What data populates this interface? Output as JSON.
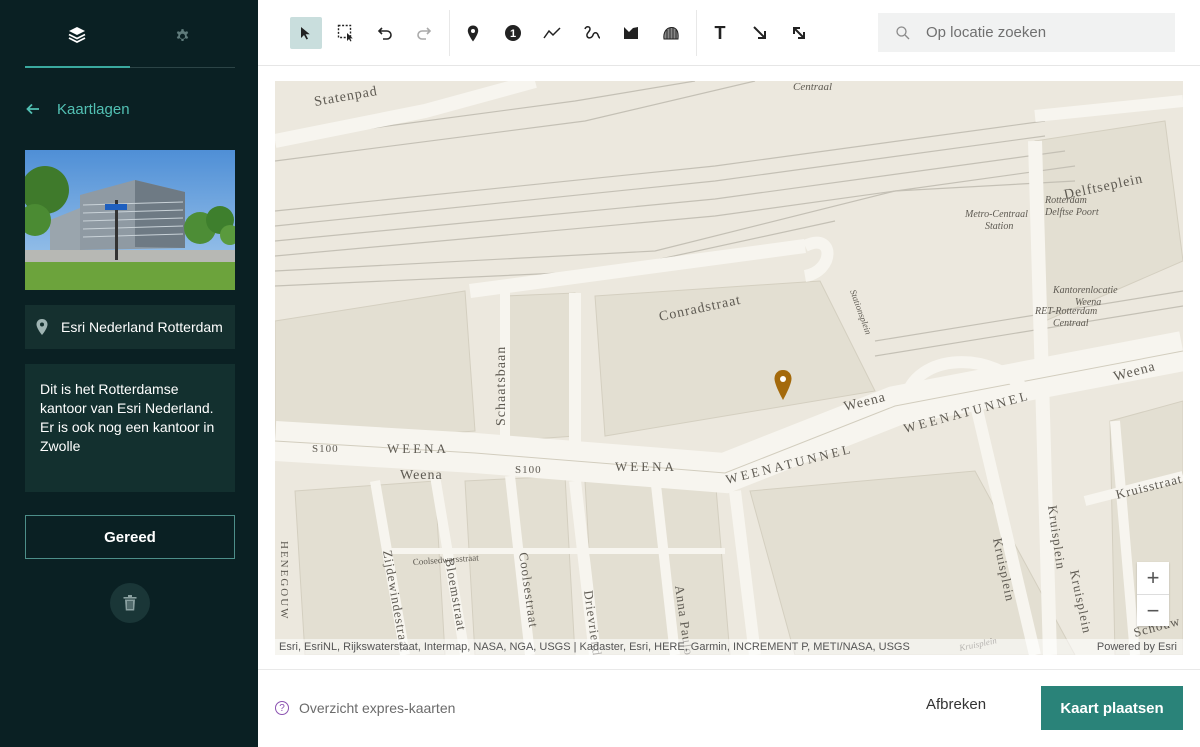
{
  "sidebar": {
    "tabs": [
      {
        "name": "layers-icon"
      },
      {
        "name": "gear-icon"
      }
    ],
    "back_label": "Kaartlagen",
    "location_text": "Esri Nederland  Rotterdam",
    "description": "Dit is het Rotterdamse kantoor van Esri Nederland. Er is ook nog een kantoor in Zwolle",
    "done_label": "Gereed"
  },
  "toolbar": {
    "tools": [
      "select-icon",
      "box-select-icon",
      "undo-icon",
      "redo-icon",
      "pin-icon",
      "numbered-marker-icon",
      "line-icon",
      "freehand-icon",
      "polygon-icon",
      "freehand-area-icon",
      "text-icon",
      "arrow-icon",
      "double-arrow-icon"
    ],
    "marker_number": "1",
    "text_tool_glyph": "T",
    "search_placeholder": "Op locatie zoeken"
  },
  "map": {
    "labels": {
      "statenpad": "Statenpad",
      "centraal_top": "Centraal",
      "delftseplein": "Delftseplein",
      "rotterdam_delftse_poort": "Rotterdam Delftse Poort",
      "metro_centraal_station": "Metro-Centraal Station",
      "conradstraat": "Conradstraat",
      "stationsplein": "Stationsplein",
      "kantorenlocatie_weena": "Kantorenlocatie Weena",
      "ret_rotterdam_centraal": "RET-Rotterdam Centraal",
      "schaatsbaan": "Schaatsbaan",
      "weena_1": "Weena",
      "weena_2": "WEENA",
      "weena_3": "Weena",
      "weena_4": "WEENA",
      "weena_right": "Weena",
      "weenatunnel_1": "WEENATUNNEL",
      "weenatunnel_2": "WEENATUNNEL",
      "s100_1": "S100",
      "s100_2": "S100",
      "kruisplein_1": "Kruisplein",
      "kruisplein_2": "Kruisplein",
      "kruisplein_3": "Kruisplein",
      "kruisplein_small": "Kruisplein",
      "kruisstraat": "Kruisstraat",
      "coolsedwarsstraat": "Coolsedwarsstraat",
      "zijdewindestraat": "Zijdewindestraat",
      "bloemstraat": "Bloemstraat",
      "coolsestraat": "Coolsestraat",
      "drievriendenstraat": "Drievriendenstraat",
      "annapaulowna": "Anna Paulowna",
      "schouwburg": "Schouw",
      "hengelo": "HENEGOUW"
    },
    "attribution": "Esri, EsriNL, Rijkswaterstaat, Intermap, NASA, NGA, USGS | Kadaster, Esri, HERE, Garmin, INCREMENT P, METI/NASA, USGS",
    "powered_by": "Powered by Esri",
    "marker_color": "#a46a0c",
    "zoom_in": "+",
    "zoom_out": "−"
  },
  "footer": {
    "help_glyph": "?",
    "overview_label": "Overzicht expres-kaarten",
    "cancel_label": "Afbreken",
    "place_label": "Kaart plaatsen"
  },
  "colors": {
    "sidebar_bg": "#0a2023",
    "accent": "#2a8379",
    "accent_light": "#52c0b3"
  }
}
